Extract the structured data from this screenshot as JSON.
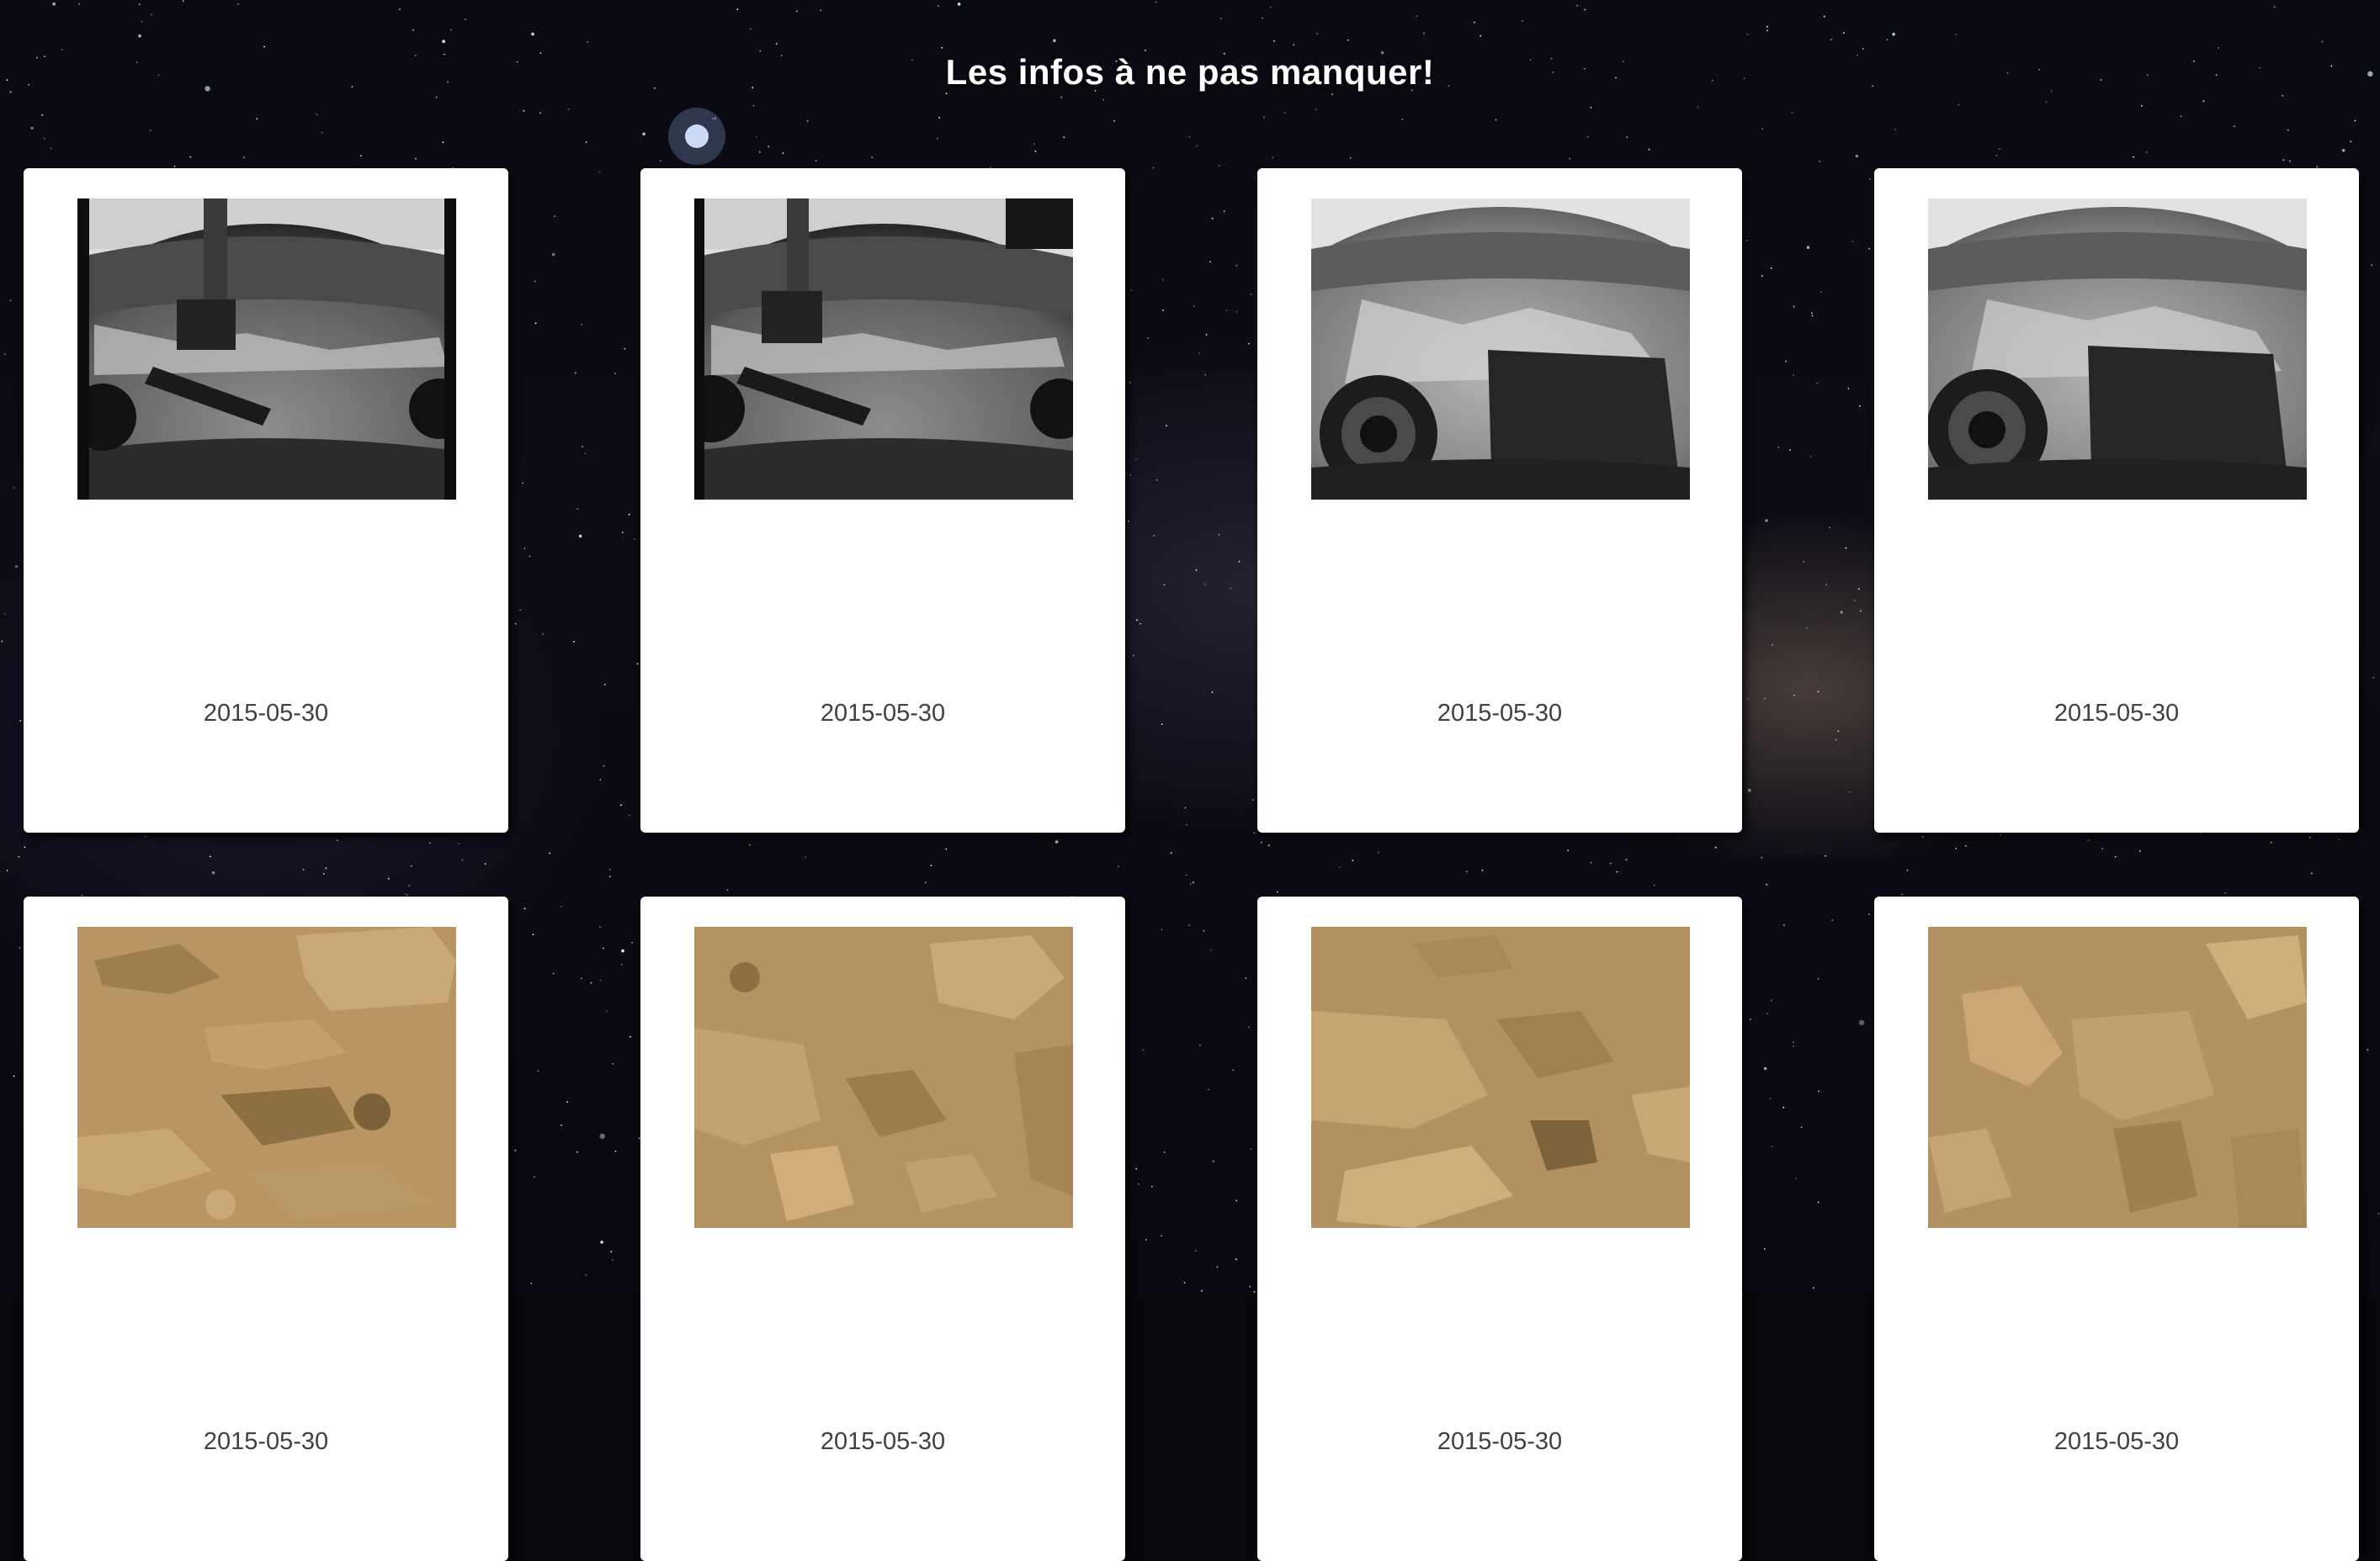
{
  "page": {
    "title": "Les infos à ne pas manquer!"
  },
  "photos": [
    {
      "date": "2015-05-30",
      "icon": "mars-rover-mast-hazcam-photo"
    },
    {
      "date": "2015-05-30",
      "icon": "mars-rover-mast-hazcam-photo"
    },
    {
      "date": "2015-05-30",
      "icon": "mars-rover-wheel-shadow-photo"
    },
    {
      "date": "2015-05-30",
      "icon": "mars-rover-wheel-shadow-photo"
    },
    {
      "date": "2015-05-30",
      "icon": "mars-surface-rocks-color-photo"
    },
    {
      "date": "2015-05-30",
      "icon": "mars-surface-rocks-color-photo"
    },
    {
      "date": "2015-05-30",
      "icon": "mars-surface-rocks-color-photo"
    },
    {
      "date": "2015-05-30",
      "icon": "mars-surface-rocks-color-photo"
    }
  ],
  "colors": {
    "card_background": "#ffffff",
    "date_text": "#3f3f46",
    "title_text": "#ffffff",
    "mars_sand": "#b79562"
  }
}
